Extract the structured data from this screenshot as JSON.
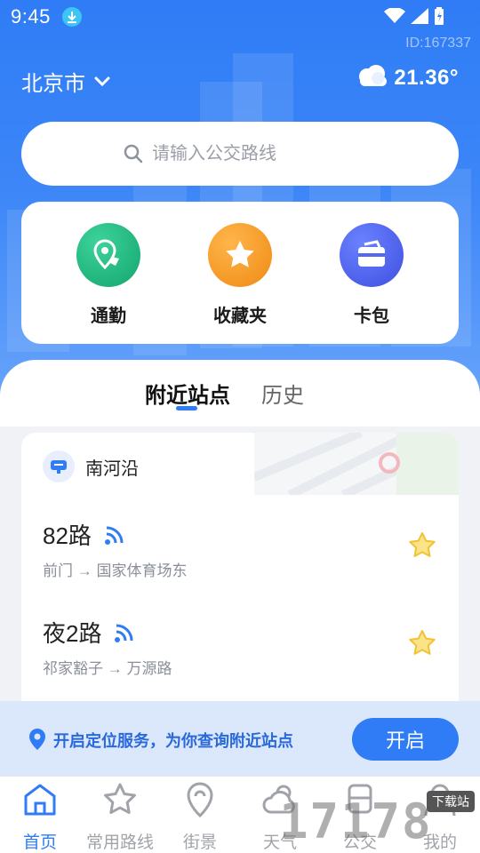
{
  "status_bar": {
    "time": "9:45"
  },
  "page_id": "ID:167337",
  "header": {
    "city": "北京市",
    "temperature": "21.36°"
  },
  "search": {
    "placeholder": "请输入公交路线"
  },
  "quick_actions": [
    {
      "label": "通勤",
      "icon": "commute-map-icon",
      "color": "#1fb57e"
    },
    {
      "label": "收藏夹",
      "icon": "star-folder-icon",
      "color": "#f49a23"
    },
    {
      "label": "卡包",
      "icon": "wallet-card-icon",
      "color": "#4f62ee"
    }
  ],
  "tabs": {
    "active": "附近站点",
    "inactive": "历史"
  },
  "station": {
    "name": "南河沿",
    "routes": [
      {
        "name": "82路",
        "direction": "前门 → 国家体育场东"
      },
      {
        "name": "夜2路",
        "direction": "祁家豁子 → 万源路"
      }
    ]
  },
  "location_prompt": {
    "text": "开启定位服务，为你查询附近站点",
    "button": "开启"
  },
  "bottom_nav": [
    {
      "label": "首页",
      "icon": "home-icon",
      "active": true
    },
    {
      "label": "常用路线",
      "icon": "star-icon",
      "active": false
    },
    {
      "label": "街景",
      "icon": "location-pin-icon",
      "active": false
    },
    {
      "label": "天气",
      "icon": "weather-icon",
      "active": false
    },
    {
      "label": "公交",
      "icon": "bus-icon",
      "active": false
    },
    {
      "label": "我的",
      "icon": "profile-icon",
      "active": false
    }
  ],
  "watermark": {
    "digits": "17178",
    "badge": "下载站"
  },
  "colors": {
    "primary": "#2f7cf6",
    "star": "#f7d154"
  }
}
